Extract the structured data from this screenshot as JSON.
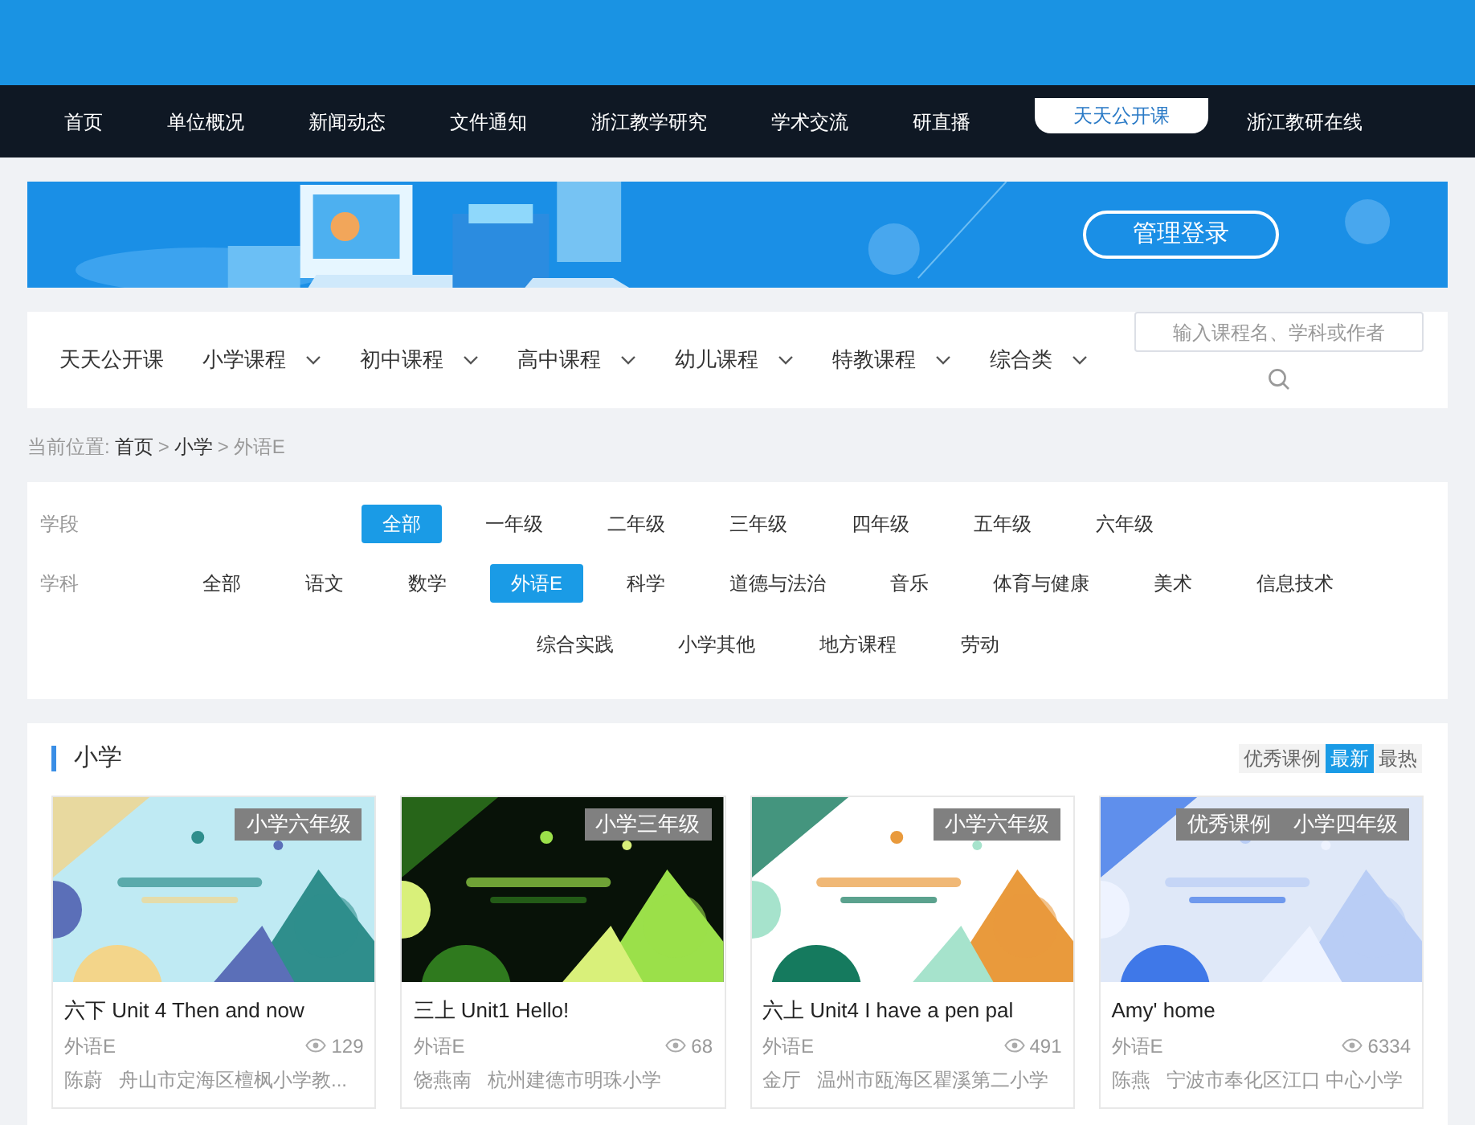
{
  "top_nav": [
    {
      "label": "首页",
      "selected": false
    },
    {
      "label": "单位概况",
      "selected": false
    },
    {
      "label": "新闻动态",
      "selected": false
    },
    {
      "label": "文件通知",
      "selected": false
    },
    {
      "label": "浙江教学研究",
      "selected": false
    },
    {
      "label": "学术交流",
      "selected": false
    },
    {
      "label": "研直播",
      "selected": false
    },
    {
      "label": "天天公开课",
      "selected": true
    },
    {
      "label": "浙江教研在线",
      "selected": false
    }
  ],
  "banner": {
    "button": "管理登录"
  },
  "course_nav": {
    "items": [
      {
        "label": "天天公开课",
        "kind": "link"
      },
      {
        "label": "小学课程",
        "kind": "dropdown"
      },
      {
        "label": "初中课程",
        "kind": "dropdown"
      },
      {
        "label": "高中课程",
        "kind": "dropdown"
      },
      {
        "label": "幼儿课程",
        "kind": "dropdown"
      },
      {
        "label": "特教课程",
        "kind": "dropdown"
      },
      {
        "label": "综合类",
        "kind": "dropdown"
      }
    ],
    "search": {
      "placeholder": "输入课程名、学科或作者"
    }
  },
  "breadcrumb": {
    "prefix": "当前位置:",
    "items": [
      {
        "label": "首页",
        "kind": "link"
      },
      {
        "label": ">",
        "kind": "separator"
      },
      {
        "label": "小学",
        "kind": "link"
      },
      {
        "label": ">",
        "kind": "separator"
      },
      {
        "label": "外语E",
        "kind": "current"
      }
    ]
  },
  "filters": [
    {
      "label": "学段",
      "options": [
        {
          "label": "全部",
          "selected": true
        },
        {
          "label": "一年级",
          "selected": false
        },
        {
          "label": "二年级",
          "selected": false
        },
        {
          "label": "三年级",
          "selected": false
        },
        {
          "label": "四年级",
          "selected": false
        },
        {
          "label": "五年级",
          "selected": false
        },
        {
          "label": "六年级",
          "selected": false
        }
      ]
    },
    {
      "label": "学科",
      "options": [
        {
          "label": "全部",
          "selected": false
        },
        {
          "label": "语文",
          "selected": false
        },
        {
          "label": "数学",
          "selected": false
        },
        {
          "label": "外语E",
          "selected": true
        },
        {
          "label": "科学",
          "selected": false
        },
        {
          "label": "道德与法治",
          "selected": false
        },
        {
          "label": "音乐",
          "selected": false
        },
        {
          "label": "体育与健康",
          "selected": false
        },
        {
          "label": "美术",
          "selected": false
        },
        {
          "label": "信息技术",
          "selected": false
        },
        {
          "label": "综合实践",
          "selected": false
        },
        {
          "label": "小学其他",
          "selected": false
        },
        {
          "label": "地方课程",
          "selected": false
        },
        {
          "label": "劳动",
          "selected": false
        }
      ]
    }
  ],
  "section": {
    "title": "小学",
    "sort_tabs": [
      {
        "label": "优秀课例",
        "selected": false
      },
      {
        "label": "最新",
        "selected": true
      },
      {
        "label": "最热",
        "selected": false
      }
    ],
    "cards": [
      {
        "badges": [
          "小学六年级"
        ],
        "title": "六下 Unit 4 Then and now",
        "subject": "外语E",
        "views": "129",
        "author": "陈蔚",
        "school": "舟山市定海区檀枫小学教..."
      },
      {
        "badges": [
          "小学三年级"
        ],
        "title": "三上 Unit1 Hello!",
        "subject": "外语E",
        "views": "68",
        "author": "饶燕南",
        "school": "杭州建德市明珠小学"
      },
      {
        "badges": [
          "小学六年级"
        ],
        "title": "六上 Unit4 I have a pen pal",
        "subject": "外语E",
        "views": "491",
        "author": "金厅",
        "school": "温州市瓯海区瞿溪第二小学"
      },
      {
        "badges": [
          "优秀课例",
          "小学四年级"
        ],
        "title": "Amy' home",
        "subject": "外语E",
        "views": "6334",
        "author": "陈燕",
        "school": "宁波市奉化区江口 中心小学"
      }
    ]
  }
}
